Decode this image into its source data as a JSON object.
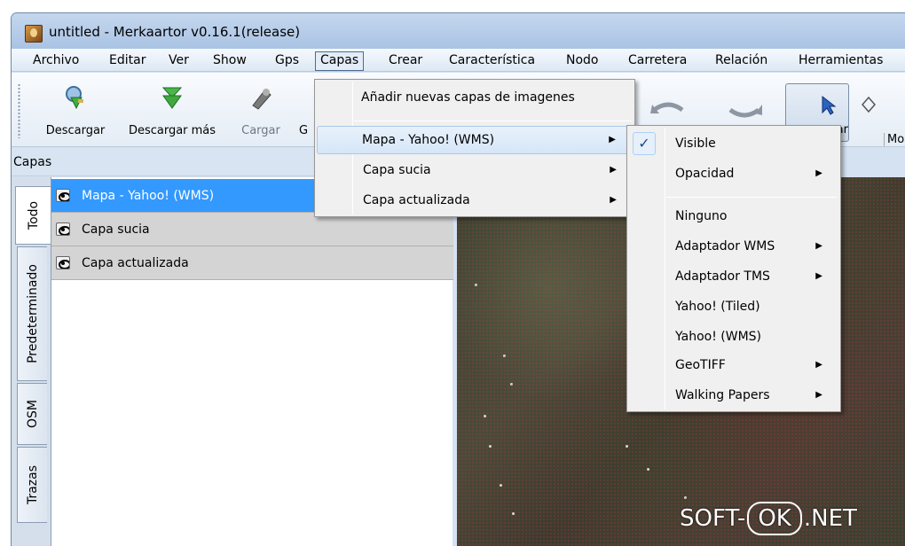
{
  "window": {
    "title": "untitled - Merkaartor v0.16.1(release)"
  },
  "menubar": [
    {
      "label": "Archivo"
    },
    {
      "label": "Editar"
    },
    {
      "label": "Ver"
    },
    {
      "label": "Show"
    },
    {
      "label": "Gps"
    },
    {
      "label": "Capas"
    },
    {
      "label": "Crear"
    },
    {
      "label": "Característica"
    },
    {
      "label": "Nodo"
    },
    {
      "label": "Carretera"
    },
    {
      "label": "Relación"
    },
    {
      "label": "Herramientas"
    }
  ],
  "toolbar": {
    "download": "Descargar",
    "download_more": "Descargar más",
    "upload": "Cargar",
    "partial_label": "G",
    "select_partial": "onar",
    "move_partial": "Mo"
  },
  "dock": {
    "title": "Capas",
    "tabs": [
      "Todo",
      "Predeterminado",
      "OSM",
      "Trazas"
    ],
    "layers": [
      {
        "name": "Mapa - Yahoo! (WMS)",
        "selected": true
      },
      {
        "name": "Capa sucia",
        "selected": false
      },
      {
        "name": "Capa actualizada",
        "selected": false
      }
    ]
  },
  "capas_menu": {
    "add_images": "Añadir nuevas capas de imagenes",
    "items": [
      "Mapa - Yahoo! (WMS)",
      "Capa sucia",
      "Capa actualizada"
    ]
  },
  "submenu": {
    "checkmark": "✓",
    "visible": "Visible",
    "opacity": "Opacidad",
    "adapters": [
      "Ninguno",
      "Adaptador WMS",
      "Adaptador TMS",
      "Yahoo! (Tiled)",
      "Yahoo! (WMS)",
      "GeoTIFF",
      "Walking Papers"
    ]
  },
  "icons": {
    "submenu_arrow": "▶"
  },
  "watermark": {
    "pre": "SOFT-",
    "ok": "OK",
    "post": ".NET"
  }
}
